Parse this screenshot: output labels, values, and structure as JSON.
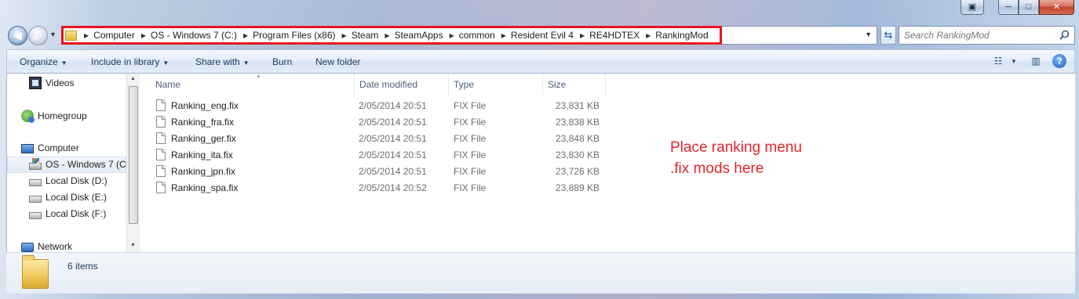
{
  "window": {
    "caption_buttons": [
      "▣",
      "─",
      "□",
      "✕"
    ]
  },
  "nav": {
    "back_icon": "arrow-left-icon",
    "forward_icon": "arrow-right-icon",
    "recent_icon": "chevron-down-icon"
  },
  "address": {
    "crumbs": [
      "Computer",
      "OS - Windows 7 (C:)",
      "Program Files (x86)",
      "Steam",
      "SteamApps",
      "common",
      "Resident Evil 4",
      "RE4HDTEX",
      "RankingMod"
    ],
    "highlight_color": "#e8161d"
  },
  "search": {
    "placeholder": "Search RankingMod"
  },
  "toolbar": {
    "organize": "Organize",
    "include": "Include in library",
    "share": "Share with",
    "burn": "Burn",
    "new_folder": "New folder"
  },
  "tree": {
    "videos": "Videos",
    "homegroup": "Homegroup",
    "computer": "Computer",
    "os_drive": "OS - Windows 7 (C:",
    "disk_d": "Local Disk (D:)",
    "disk_e": "Local Disk (E:)",
    "disk_f": "Local Disk (F:)",
    "network": "Network"
  },
  "columns": {
    "name": "Name",
    "date": "Date modified",
    "type": "Type",
    "size": "Size"
  },
  "files": [
    {
      "name": "Ranking_eng.fix",
      "date": "2/05/2014 20:51",
      "type": "FIX File",
      "size": "23,831 KB"
    },
    {
      "name": "Ranking_fra.fix",
      "date": "2/05/2014 20:51",
      "type": "FIX File",
      "size": "23,838 KB"
    },
    {
      "name": "Ranking_ger.fix",
      "date": "2/05/2014 20:51",
      "type": "FIX File",
      "size": "23,848 KB"
    },
    {
      "name": "Ranking_ita.fix",
      "date": "2/05/2014 20:51",
      "type": "FIX File",
      "size": "23,830 KB"
    },
    {
      "name": "Ranking_jpn.fix",
      "date": "2/05/2014 20:51",
      "type": "FIX File",
      "size": "23,726 KB"
    },
    {
      "name": "Ranking_spa.fix",
      "date": "2/05/2014 20:52",
      "type": "FIX File",
      "size": "23,889 KB"
    }
  ],
  "annotation": {
    "text": "Place ranking menu\n.fix mods here",
    "color": "#e0262d"
  },
  "details": {
    "count": "6 items"
  }
}
